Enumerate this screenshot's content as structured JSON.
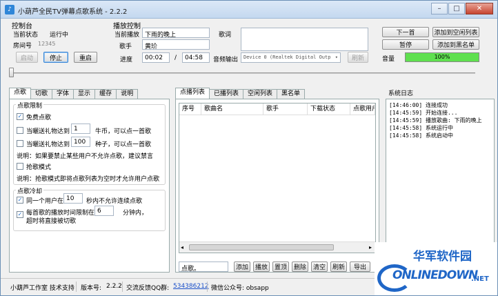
{
  "window": {
    "title": "小葫芦全民TV弹幕点歌系统 - 2.2.2",
    "app_icon": "♪",
    "minimize": "–",
    "maximize": "□",
    "close": "✕"
  },
  "console": {
    "group_label": "控制台",
    "status_label": "当前状态",
    "status_value": "运行中",
    "room_label": "房间号",
    "room_value": "12345",
    "start_label": "启动",
    "stop_label": "停止",
    "restart_label": "重启"
  },
  "playback": {
    "group_label": "播放控制",
    "current_label": "当前播放",
    "current_value": "下雨的晚上",
    "lyrics_label": "歌词",
    "singer_label": "歌手",
    "singer_value": "黄玠",
    "progress_label": "进度",
    "elapsed": "00:02",
    "separator": "/",
    "total": "04:58",
    "output_label": "音频输出",
    "output_value": "Device 0 (Realtek Digital Outp",
    "refresh_label": "刷新",
    "position_fraction": 0.0
  },
  "actions": {
    "next_label": "下一首",
    "add_idle_label": "添加到空闲列表",
    "pause_label": "暂停",
    "add_black_label": "添加到黑名单",
    "volume_label": "音量",
    "volume_value": "100%",
    "volume_fraction": 1.0
  },
  "left_tabs": [
    "点歌",
    "切歌",
    "字体",
    "显示",
    "缓存",
    "说明"
  ],
  "song_limit": {
    "group_label": "点歌限制",
    "free_label": "免费点歌",
    "free_checked": true,
    "gift1_prefix": "当曬送礼物达到",
    "gift1_value": "1",
    "gift1_suffix": "牛币，可以点一首歌",
    "gift2_prefix": "当曬送礼物达到",
    "gift2_value": "100",
    "gift2_suffix": "种子，可以点一首歌",
    "note1": "说明：如果要禁止某些用户不允许点歌，建议禁言",
    "grab_label": "抢歌模式",
    "note2": "说明：抢歌模式即将点歌列表为空时才允许用户点歌"
  },
  "cooldown": {
    "group_label": "点歌冷却",
    "same_user_prefix": "同一个用户在",
    "same_user_value": "10",
    "same_user_suffix": "秒内不允许连续点歌",
    "limit_prefix": "每首歌的播放时间限制在",
    "limit_value": "6",
    "limit_suffix": "分钟内，",
    "limit_line2": "超时将直接被切歌"
  },
  "list_tabs": [
    "点播列表",
    "已播列表",
    "空闲列表",
    "黑名单"
  ],
  "table": {
    "columns": [
      "序号",
      "歌曲名",
      "歌手",
      "下载状态",
      "点歌用户"
    ]
  },
  "list_bottom": {
    "input_value": "点歌。",
    "buttons": [
      "添加",
      "播放",
      "置顶",
      "删除",
      "清空",
      "刷新",
      "导出"
    ]
  },
  "log": {
    "label": "系统日志",
    "lines": [
      "[14:46:00] 连接成功",
      "[14:45:59] 开始连接...",
      "[14:45:59] 播放歌曲: 下雨的晚上",
      "[14:45:58] 系统运行中",
      "[14:45:58] 系统启动中"
    ]
  },
  "statusbar": {
    "support": "小葫芦工作室 技术支持",
    "version_label": "版本号:",
    "version_value": "2.2.2",
    "qq_label": "交流反馈QQ群:",
    "qq_value": "534386212",
    "wechat": "微信公众号: obsapp"
  },
  "watermark": {
    "line1": "华军软件园",
    "line2": "ONLINEDOWN",
    "suffix": ".NET"
  },
  "colors": {
    "volume_green": "#5fe04f",
    "link_blue": "#1a4fc9",
    "watermark_blue": "#1f66c7"
  }
}
